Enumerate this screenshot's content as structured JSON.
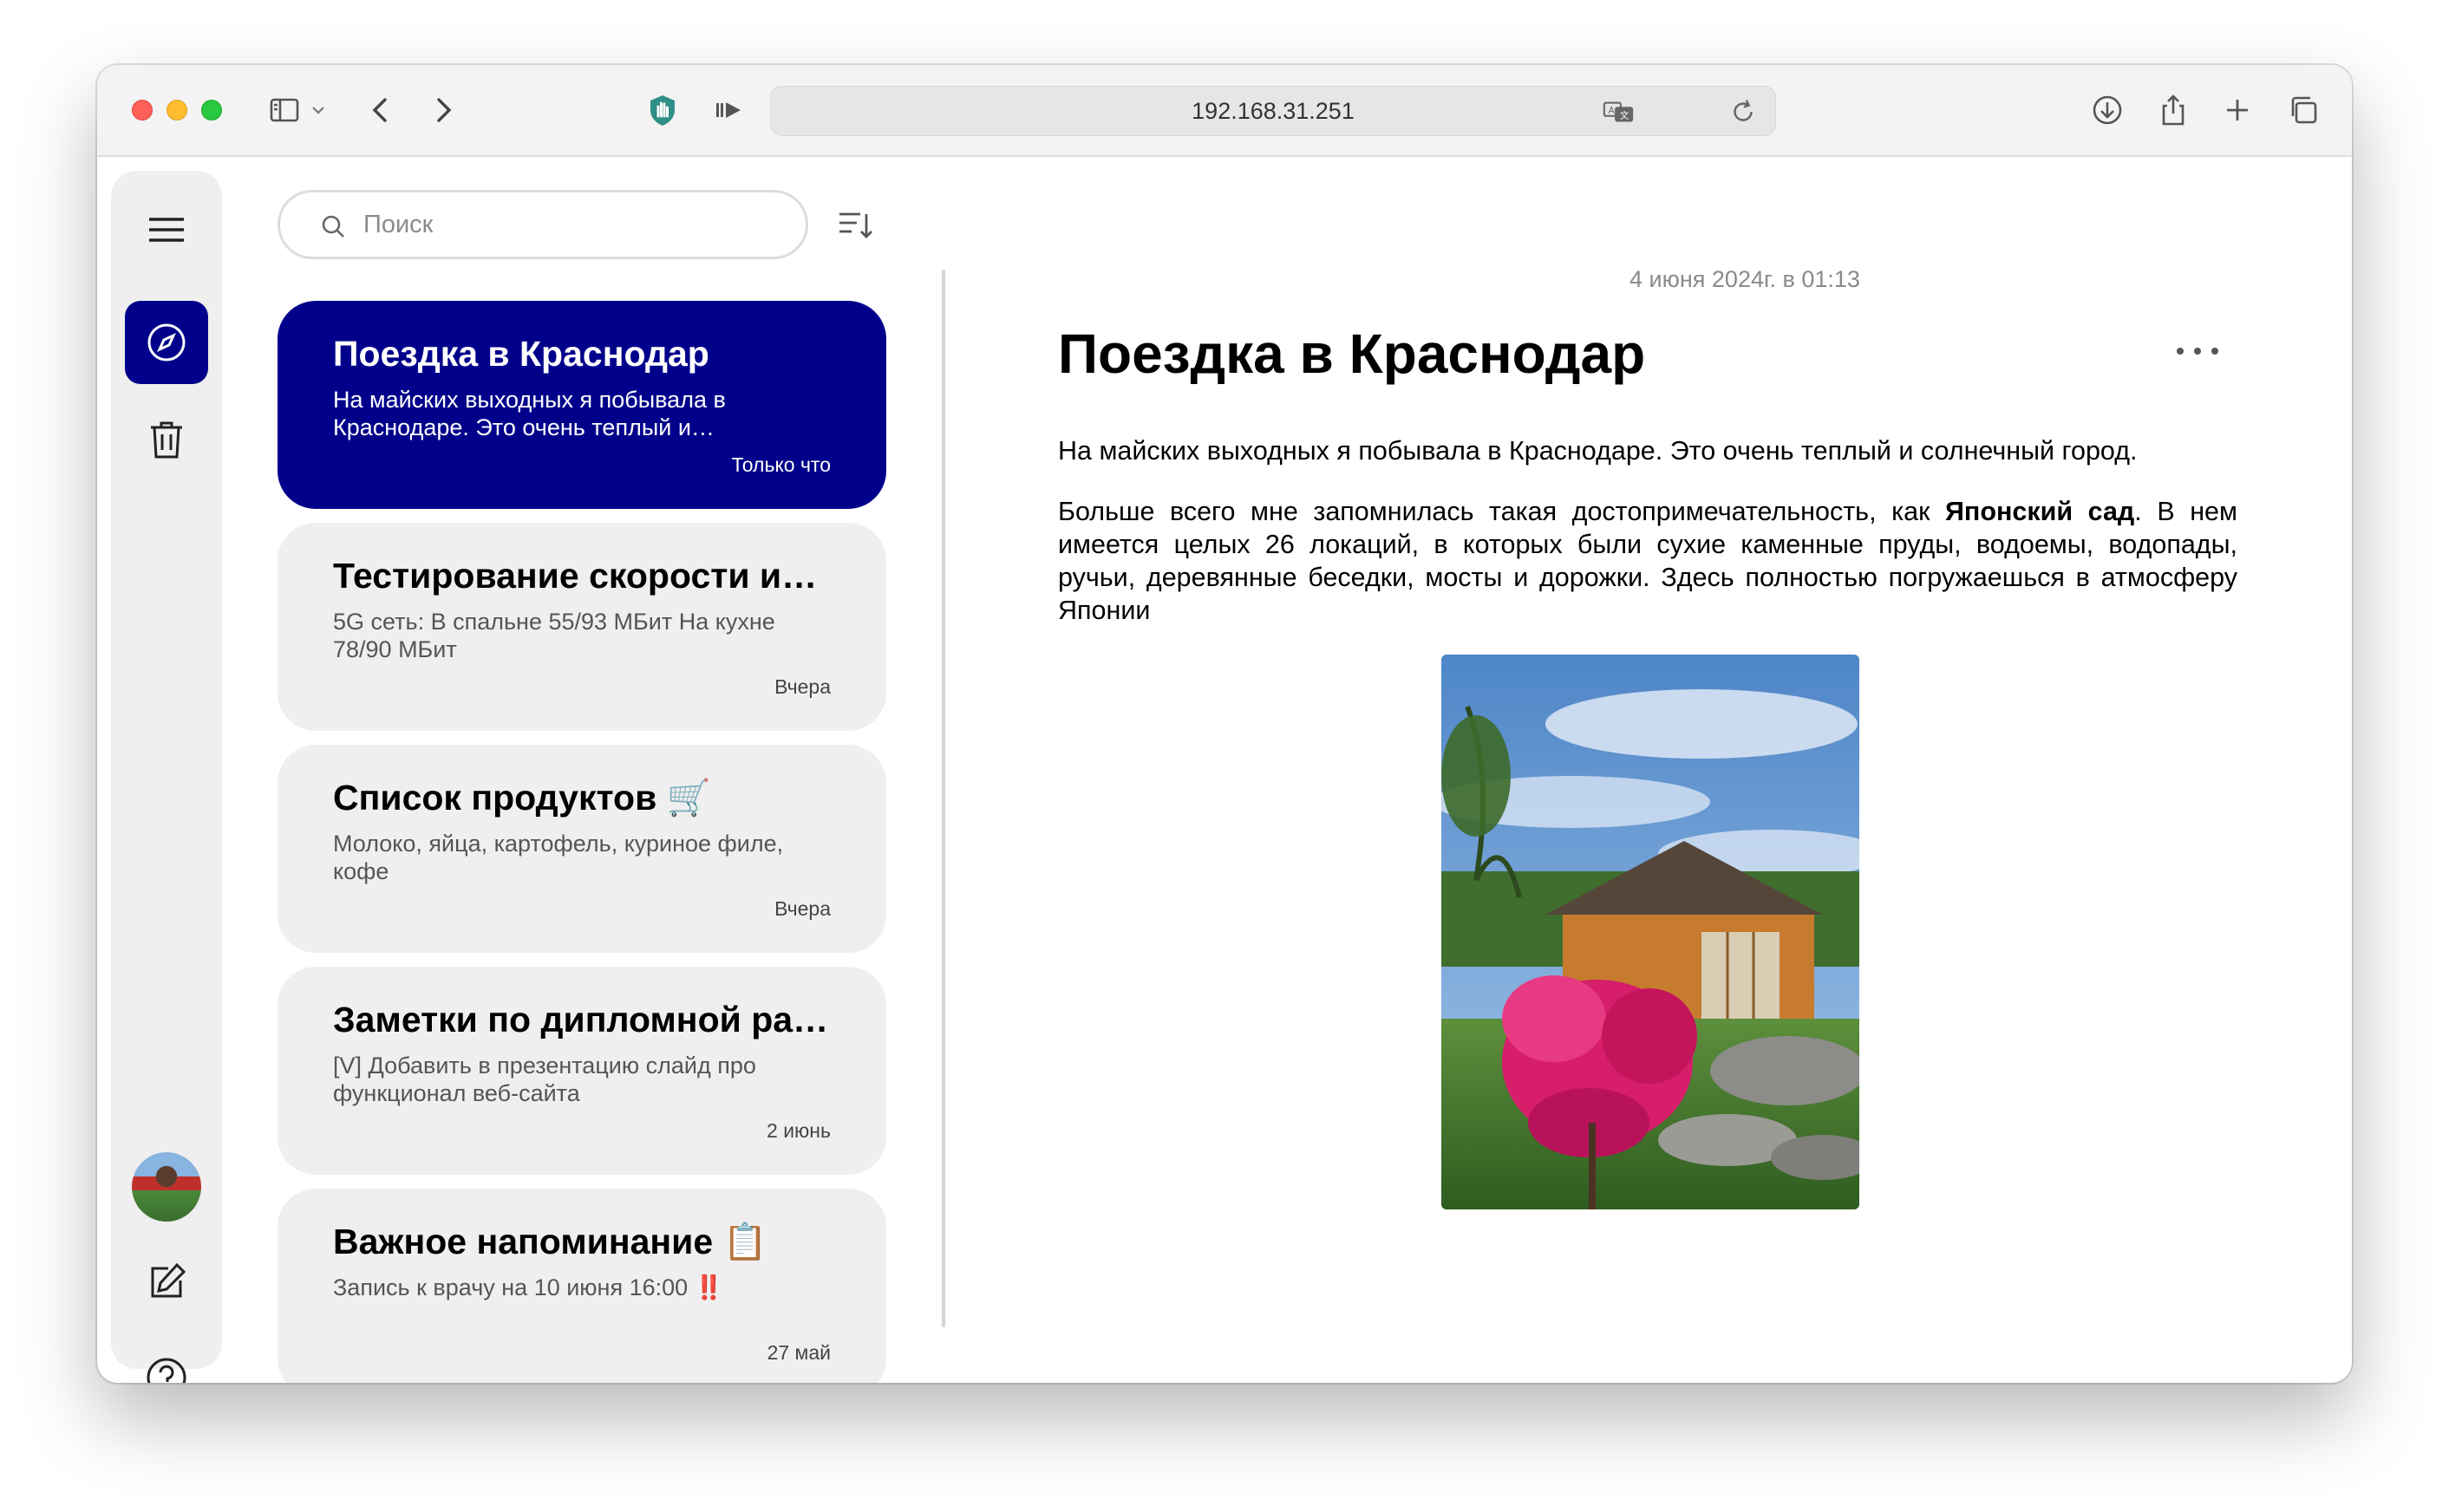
{
  "browser": {
    "url": "192.168.31.251"
  },
  "search": {
    "placeholder": "Поиск"
  },
  "notes": [
    {
      "title": "Поездка в Краснодар",
      "preview": "На майских выходных я побывала в Краснодаре. Это очень теплый и…",
      "date": "Только что",
      "selected": true
    },
    {
      "title": "Тестирование скорости инте…",
      "preview": "5G сеть: В спальне 55/93 МБит На кухне 78/90 МБит",
      "date": "Вчера"
    },
    {
      "title": "Список продуктов 🛒",
      "preview": "Молоко, яйца, картофель, куриное филе, кофе",
      "date": "Вчера"
    },
    {
      "title": "Заметки по дипломной рабо…",
      "preview": "[V] Добавить в презентацию слайд про функционал веб-сайта",
      "date": "2 июнь"
    },
    {
      "title": "Важное напоминание 📋",
      "preview": "Запись к врачу на 10 июня 16:00 ‼️",
      "date": "27 май"
    }
  ],
  "detail": {
    "date": "4 июня 2024г. в 01:13",
    "title": "Поездка в Краснодар",
    "paragraph1": "На майских выходных я побывала в Краснодаре. Это очень теплый и солнечный город.",
    "paragraph2_before": "Больше всего мне запомнилась такая достопримечательность, как ",
    "paragraph2_bold": "Японский сад",
    "paragraph2_after": ". В нем имеется целых 26 локаций, в которых были сухие каменные пруды, водоемы, водопады, ручьи, деревянные беседки, мосты и дорожки. Здесь полностью погружаешься в атмосферу Японии"
  },
  "icons": {
    "sidebar_toggle": "sidebar-icon",
    "back": "chevron-left-icon",
    "forward": "chevron-right-icon",
    "extension": "hand-shield-icon",
    "media": "play-icon",
    "translate": "translate-icon",
    "reload": "reload-icon",
    "download": "download-icon",
    "share": "share-icon",
    "new_tab": "plus-icon",
    "tabs": "tabs-overview-icon",
    "menu": "hamburger-icon",
    "explore": "compass-icon",
    "trash": "trash-icon",
    "new_note": "compose-icon",
    "help": "help-icon",
    "sort": "sort-icon",
    "more": "more-icon"
  },
  "colors": {
    "accent": "#00008b",
    "card_bg": "#efefef",
    "rail_bg": "#efefef"
  }
}
